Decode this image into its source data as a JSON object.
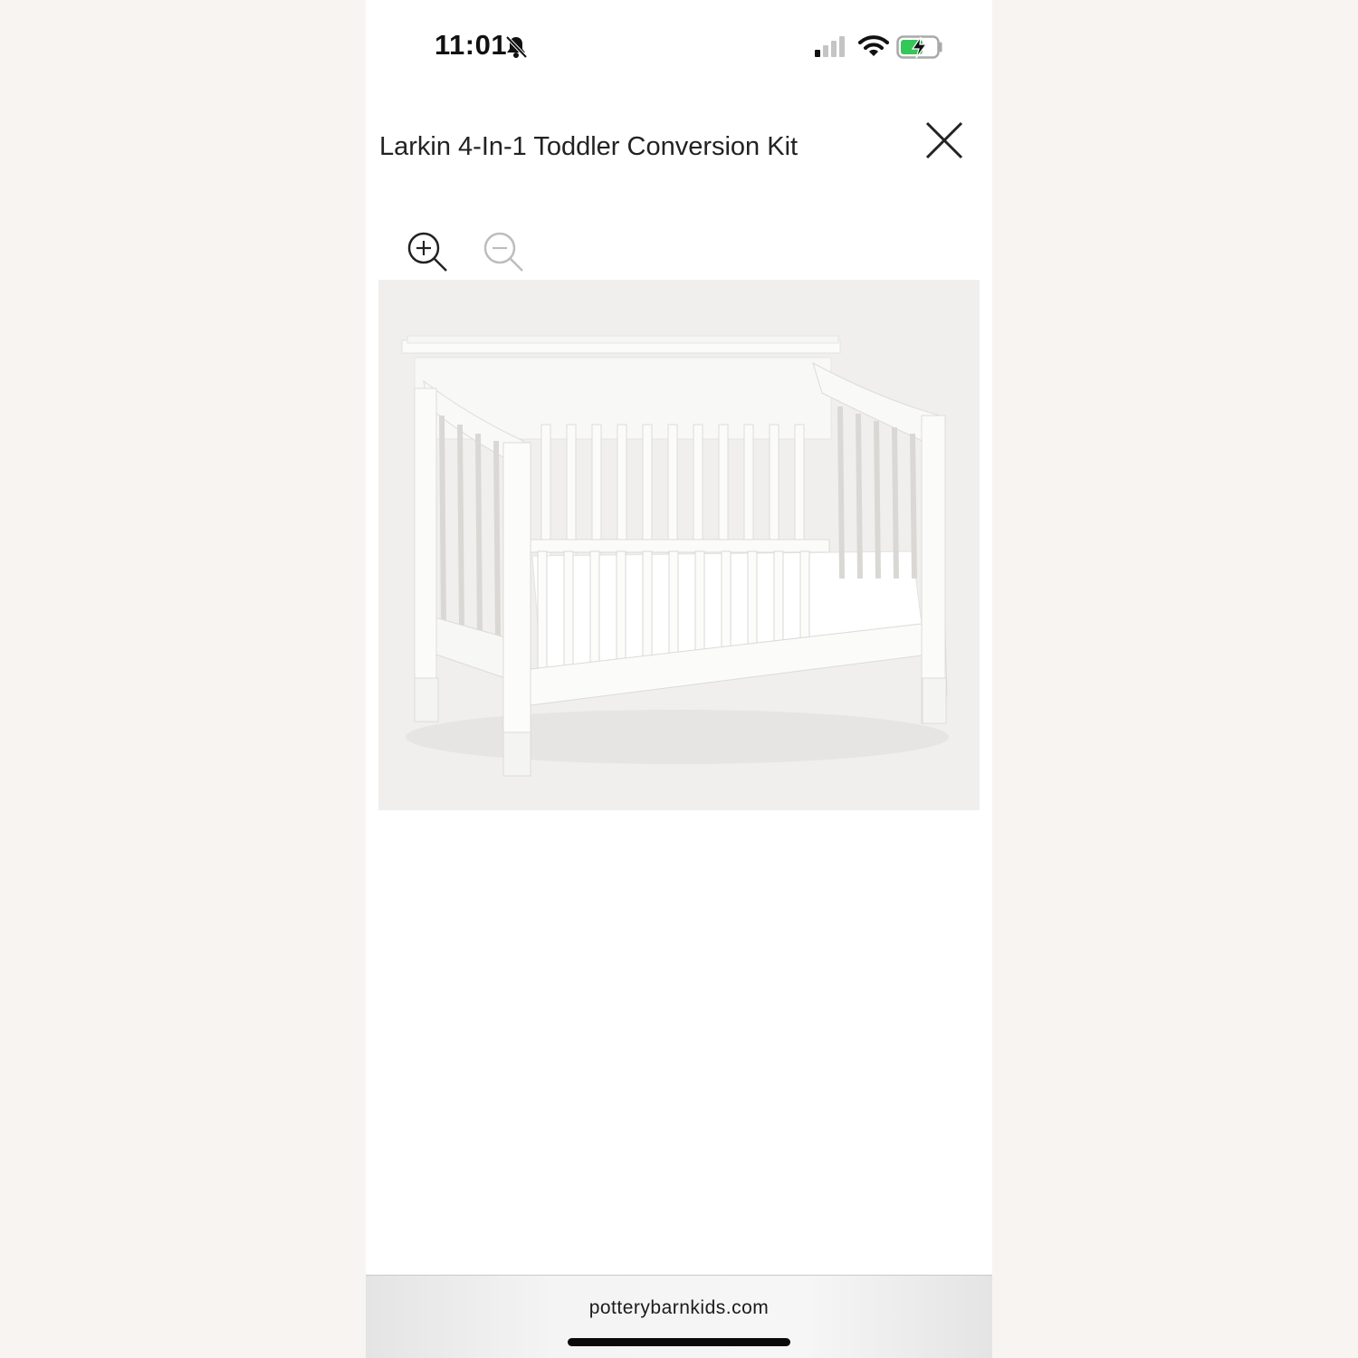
{
  "status_bar": {
    "time": "11:01",
    "icons": [
      "bell-slash-icon",
      "cellular-signal-icon",
      "wifi-icon",
      "battery-charging-icon"
    ],
    "battery_color": "#34c759"
  },
  "header": {
    "title": "Larkin 4-In-1 Toddler Conversion Kit",
    "close_icon": "close-icon"
  },
  "zoom_controls": {
    "zoom_in_icon": "zoom-in-icon",
    "zoom_out_icon": "zoom-out-icon"
  },
  "product_image": {
    "icon": "toddler-crib-image"
  },
  "browser_bar": {
    "url": "potterybarnkids.com"
  }
}
